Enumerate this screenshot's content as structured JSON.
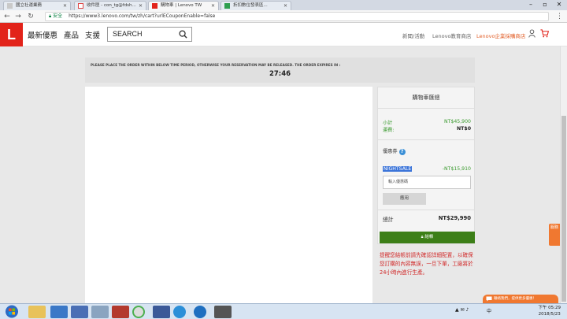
{
  "browser": {
    "tabs": [
      {
        "label": "國立社運業務"
      },
      {
        "label": "收件匣 - con_tg@fdsh..."
      },
      {
        "label": "購物車 | Lenovo TW"
      },
      {
        "label": "折扣數位發表區..."
      }
    ],
    "security_label": "安全",
    "url": "https://www3.lenovo.com/tw/zh/cart?urlECouponEnable=false"
  },
  "header": {
    "logo": "L",
    "nav": [
      "最新優惠",
      "產品",
      "支援"
    ],
    "search_placeholder": "SEARCH",
    "links": [
      "新聞/活動",
      "Lenovo教育商店",
      "Lenovo企業採購商店"
    ]
  },
  "timer": {
    "message": "PLEASE PLACE THE ORDER WITHIN BELOW TIME PERIOD, OTHERWISE YOUR RESERVATION MAY BE RELEASED. THE ORDER EXPIRES IN :",
    "countdown": "27:46"
  },
  "cart": {
    "title": "購物車匯總",
    "subtotal_label": "小計",
    "subtotal_value": "NT$45,900",
    "shipping_label": "運費:",
    "shipping_value": "NT$0",
    "coupon_label": "優惠券",
    "coupon_code": "NIGHTSALE",
    "coupon_discount": "-NT$15,910",
    "coupon_placeholder": "輸入優惠碼",
    "apply_label": "應用",
    "total_label": "總計",
    "total_value": "NT$29,990",
    "checkout_label": "結帳"
  },
  "notice": "提醒您結帳前請先確認詳細配置，以確保您訂購的內容無誤，一旦下單，工廠將於24小時內進行生產。",
  "side_tab": "服務",
  "chat_label": "聯絡我們，提供更多優惠！",
  "taskbar": {
    "tray_text": "中",
    "time": "下午 05:29",
    "date": "2018/5/23"
  },
  "colors": {
    "brand_red": "#e2231a",
    "accent_green": "#3a9a2e",
    "checkout_green": "#3c7f18",
    "notice_red": "#d12a2a",
    "orange": "#f07830"
  }
}
